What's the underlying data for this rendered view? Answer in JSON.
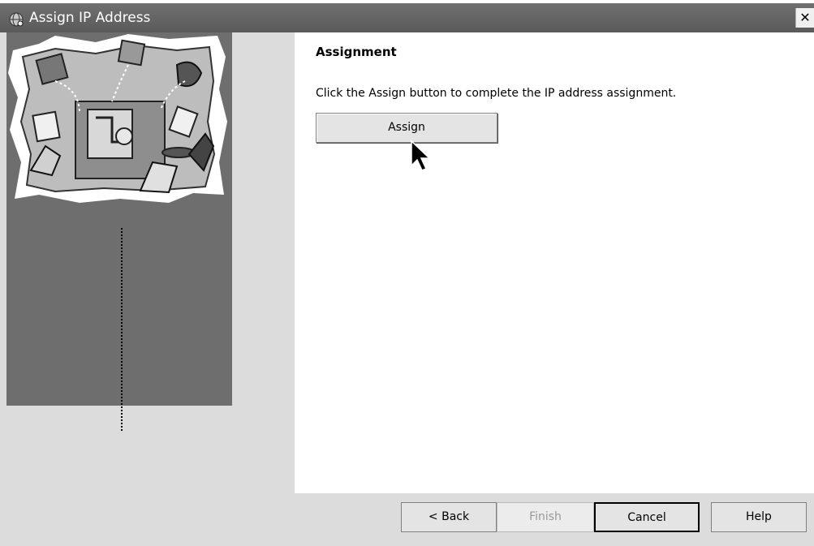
{
  "window": {
    "title": "Assign IP Address",
    "close_label": "✕"
  },
  "content": {
    "heading": "Assignment",
    "instructions": "Click the Assign button to complete the IP address assignment.",
    "assign_label": "Assign"
  },
  "footer": {
    "back_label": "< Back",
    "finish_label": "Finish",
    "cancel_label": "Cancel",
    "help_label": "Help"
  },
  "icons": {
    "title_icon": "network-globe-icon",
    "close_icon": "close-icon",
    "cursor": "mouse-pointer-icon"
  }
}
